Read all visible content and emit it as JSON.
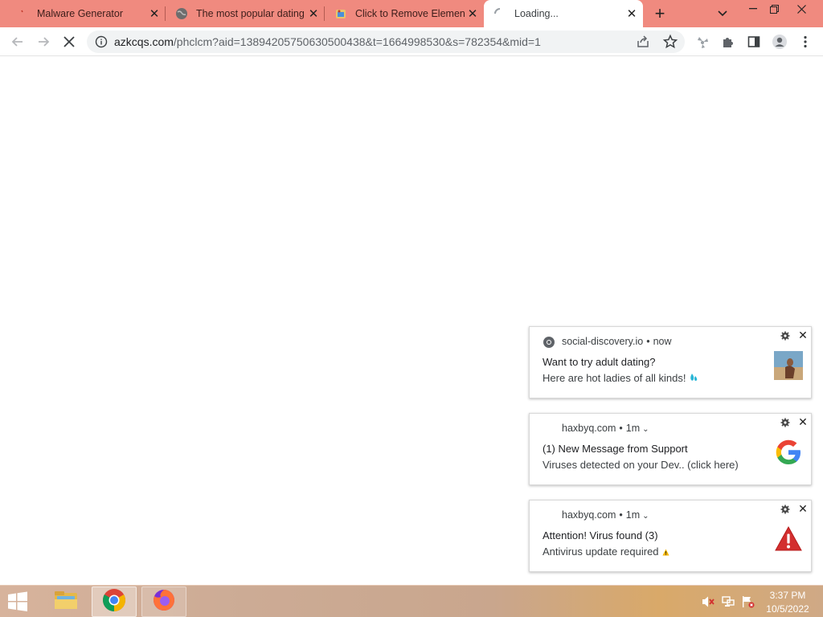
{
  "browser": {
    "tabs": [
      {
        "title": "Malware Generator",
        "icon": "red-tick-favicon",
        "active": false
      },
      {
        "title": "The most popular dating",
        "icon": "globe-favicon",
        "active": false
      },
      {
        "title": "Click to Remove Element",
        "icon": "cartoon-favicon",
        "active": false
      },
      {
        "title": "Loading...",
        "icon": "loading-spinner",
        "active": true
      }
    ],
    "url_host": "azkcqs.com",
    "url_path": "/phclcm?aid=13894205750630500438&t=1664998530&s=782354&mid=1",
    "tabstrip_color": "#f08a7f"
  },
  "notifications": [
    {
      "origin": "social-discovery.io",
      "time": "now",
      "title": "Want to try adult dating?",
      "body": "Here are hot ladies of all kinds!",
      "body_suffix_icon": "water-drop-emoji",
      "image": "photo-thumbnail"
    },
    {
      "origin": "haxbyq.com",
      "time": "1m",
      "title": "(1) New Message from Support",
      "body": "Viruses detected on your Dev.. (click here)",
      "image": "google-g-logo"
    },
    {
      "origin": "haxbyq.com",
      "time": "1m",
      "title": "Attention! Virus found (3)",
      "body": "Antivirus update required",
      "body_suffix_icon": "warning-emoji",
      "image": "red-warning-triangle"
    }
  ],
  "taskbar": {
    "apps": [
      "file-explorer",
      "chrome",
      "firefox"
    ],
    "time": "3:37 PM",
    "date": "10/5/2022"
  }
}
